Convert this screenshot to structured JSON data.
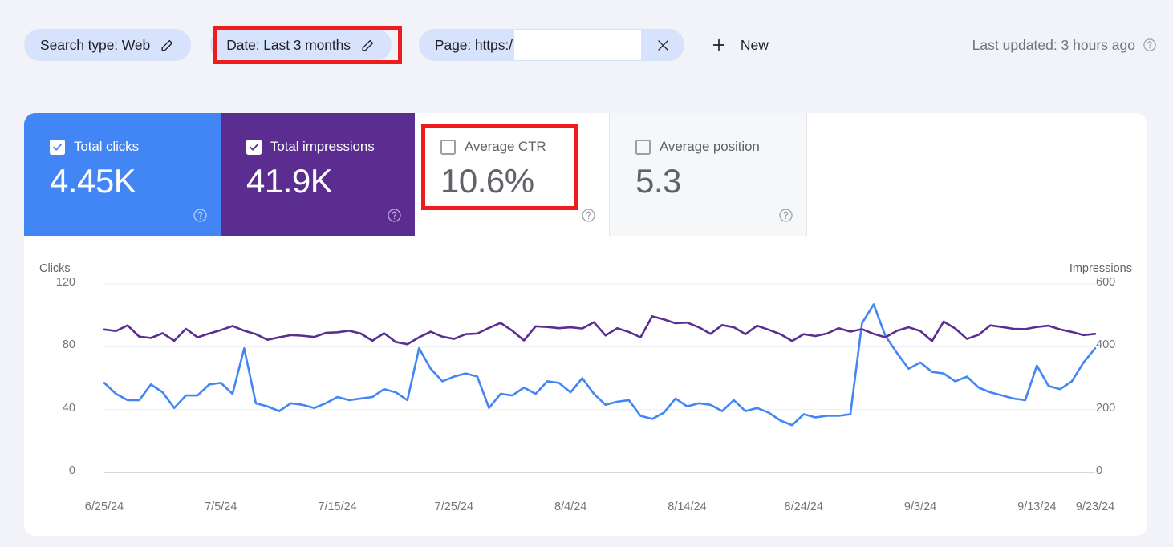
{
  "filters": {
    "search_type": {
      "label": "Search type: Web",
      "icon": "pencil-icon"
    },
    "date": {
      "label": "Date: Last 3 months",
      "icon": "pencil-icon"
    },
    "page": {
      "label": "Page: https:/",
      "value_redacted": "",
      "close_icon": "close-icon"
    },
    "new_button": {
      "label": "New",
      "icon": "plus-icon"
    },
    "last_updated": {
      "label": "Last updated: 3 hours ago",
      "icon": "help-icon"
    }
  },
  "metrics": [
    {
      "id": "total-clicks",
      "title": "Total clicks",
      "value": "4.45K",
      "checked": true,
      "color": "#4285f4",
      "help": "?"
    },
    {
      "id": "total-impressions",
      "title": "Total impressions",
      "value": "41.9K",
      "checked": true,
      "color": "#5c2d91",
      "help": "?"
    },
    {
      "id": "average-ctr",
      "title": "Average CTR",
      "value": "10.6%",
      "checked": false,
      "color": "#ffffff",
      "help": "?"
    },
    {
      "id": "average-position",
      "title": "Average position",
      "value": "5.3",
      "checked": false,
      "color": "#f6f7f8",
      "help": "?"
    }
  ],
  "annotations": [
    {
      "id": "redbox-date",
      "target": "date-filter-chip",
      "color": "#ee1c1c"
    },
    {
      "id": "redbox-ctr",
      "target": "average-ctr-card",
      "color": "#ee1c1c"
    }
  ],
  "chart_data": {
    "type": "line",
    "title": "",
    "xlabel": "",
    "ylabel": "Clicks",
    "y2label": "Impressions",
    "ylim": [
      0,
      120
    ],
    "y2lim": [
      0,
      600
    ],
    "yticks": [
      "0",
      "40",
      "80",
      "120"
    ],
    "y2ticks": [
      "0",
      "200",
      "400",
      "600"
    ],
    "grid": true,
    "legend": "none",
    "xticks": [
      "6/25/24",
      "7/5/24",
      "7/15/24",
      "7/25/24",
      "8/4/24",
      "8/14/24",
      "8/24/24",
      "9/3/24",
      "9/13/24",
      "9/23/24"
    ],
    "x_start": "6/25/24",
    "x_end": "9/23/24",
    "series": [
      {
        "name": "Clicks",
        "color": "#4285f4",
        "axis": "left",
        "values": [
          57,
          50,
          46,
          46,
          56,
          51,
          41,
          49,
          49,
          56,
          57,
          50,
          79,
          44,
          42,
          39,
          44,
          43,
          41,
          44,
          48,
          46,
          47,
          48,
          53,
          51,
          46,
          79,
          66,
          58,
          61,
          63,
          61,
          41,
          50,
          49,
          54,
          50,
          58,
          57,
          51,
          60,
          50,
          43,
          45,
          46,
          36,
          34,
          38,
          47,
          42,
          44,
          43,
          39,
          46,
          39,
          41,
          38,
          33,
          30,
          37,
          35,
          36,
          36,
          37,
          95,
          107,
          87,
          76,
          66,
          70,
          64,
          63,
          58,
          61,
          54,
          51,
          49,
          47,
          46,
          68,
          55,
          53,
          58,
          70,
          79
        ]
      },
      {
        "name": "Impressions",
        "color": "#5c2d91",
        "axis": "right",
        "values": [
          455,
          450,
          468,
          432,
          428,
          443,
          419,
          457,
          430,
          442,
          453,
          466,
          451,
          440,
          422,
          430,
          437,
          435,
          431,
          444,
          446,
          451,
          442,
          419,
          443,
          415,
          408,
          430,
          448,
          432,
          425,
          440,
          442,
          460,
          476,
          451,
          420,
          465,
          463,
          459,
          462,
          458,
          478,
          436,
          459,
          447,
          430,
          497,
          487,
          475,
          477,
          462,
          441,
          469,
          462,
          440,
          467,
          454,
          440,
          418,
          440,
          434,
          442,
          459,
          448,
          456,
          441,
          430,
          451,
          462,
          450,
          418,
          480,
          458,
          425,
          438,
          468,
          463,
          457,
          456,
          463,
          467,
          455,
          447,
          437,
          441
        ]
      }
    ]
  }
}
